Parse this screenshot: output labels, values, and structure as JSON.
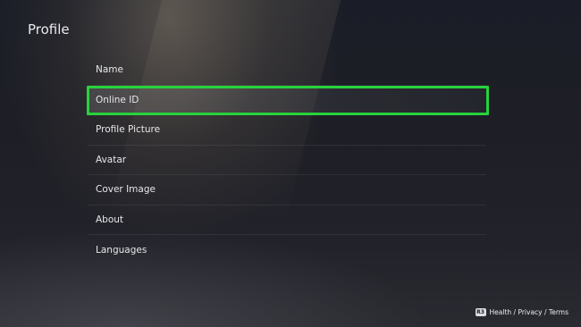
{
  "header": {
    "title": "Profile"
  },
  "menu": {
    "items": [
      {
        "label": "Name"
      },
      {
        "label": "Online ID"
      },
      {
        "label": "Profile Picture"
      },
      {
        "label": "Avatar"
      },
      {
        "label": "Cover Image"
      },
      {
        "label": "About"
      },
      {
        "label": "Languages"
      }
    ],
    "selected_index": 1
  },
  "footer": {
    "button_icon": "R3",
    "links_label": "Health / Privacy / Terms"
  },
  "colors": {
    "highlight": "#27d33c",
    "background": "#1e1f26",
    "text": "#e6e6ea"
  }
}
